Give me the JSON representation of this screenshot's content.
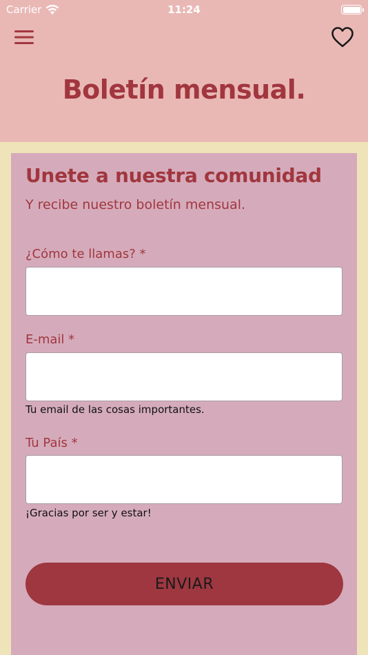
{
  "status_bar": {
    "carrier": "Carrier",
    "time": "11:24"
  },
  "header": {
    "menu_icon": "hamburger-menu-icon",
    "favorite_icon": "heart-outline-icon",
    "title": "Boletín mensual."
  },
  "form": {
    "title": "Unete a nuestra comunidad",
    "subtitle": "Y recibe nuestro boletín mensual.",
    "fields": [
      {
        "label": "¿Cómo te llamas? *",
        "value": "",
        "help": ""
      },
      {
        "label": "E-mail *",
        "value": "",
        "help": "Tu email de las cosas importantes."
      },
      {
        "label": "Tu País *",
        "value": "",
        "help": "¡Gracias por ser y estar!"
      }
    ],
    "submit_label": "ENVIAR"
  },
  "colors": {
    "header_bg": "#e9b8b5",
    "page_bg": "#efe4b9",
    "card_bg": "#d5abbb",
    "accent": "#a1363e",
    "button": "#9e3740"
  }
}
